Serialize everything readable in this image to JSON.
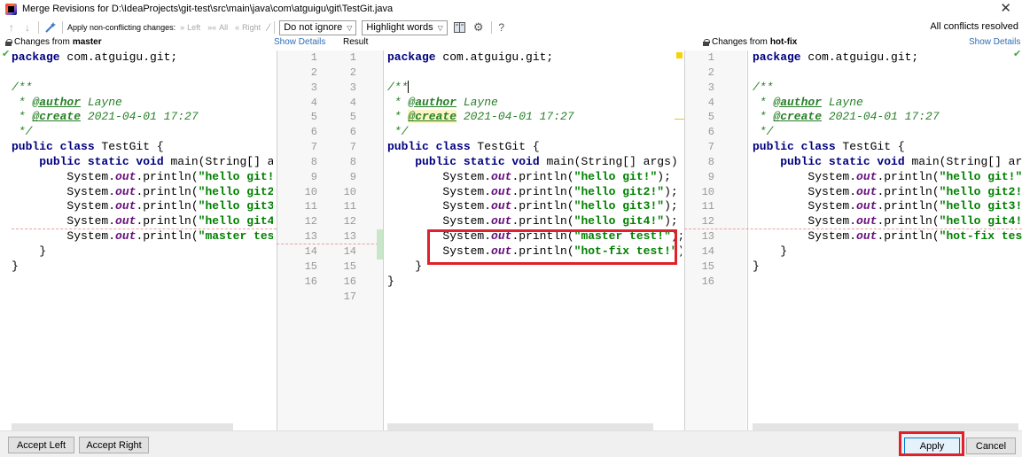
{
  "window": {
    "title": "Merge Revisions for D:\\IdeaProjects\\git-test\\src\\main\\java\\com\\atguigu\\git\\TestGit.java",
    "close_glyph": "✕"
  },
  "toolbar": {
    "up_glyph": "↑",
    "down_glyph": "↓",
    "apply_nonconflicting_label": "Apply non-conflicting changes:",
    "left_label": "Left",
    "all_label": "All",
    "right_label": "Right",
    "whitespace_option": "Do not ignore",
    "highlight_option": "Highlight words",
    "help_glyph": "?",
    "status": "All conflicts resolved"
  },
  "headers": {
    "left_prefix": "Changes from",
    "left_branch": "master",
    "left_link": "Show Details",
    "center": "Result",
    "right_prefix": "Changes from",
    "right_branch": "hot-fix",
    "right_link": "Show Details"
  },
  "gutter": {
    "left_numbers": [
      "1",
      "2",
      "3",
      "4",
      "5",
      "6",
      "7",
      "8",
      "9",
      "10",
      "11",
      "12",
      "13",
      "14",
      "15",
      "16"
    ],
    "result_numbers": [
      "1",
      "2",
      "3",
      "4",
      "5",
      "6",
      "7",
      "8",
      "9",
      "10",
      "11",
      "12",
      "13",
      "14",
      "15",
      "16",
      "17"
    ],
    "right_numbers": [
      "1",
      "2",
      "3",
      "4",
      "5",
      "6",
      "7",
      "8",
      "9",
      "10",
      "11",
      "12",
      "13",
      "14",
      "15",
      "16"
    ]
  },
  "code": {
    "package_kw": "package",
    "package_name": " com.atguigu.git;",
    "doc_open": "/**",
    "doc_star": " * ",
    "author_tag": "@author",
    "author_val": " Layne",
    "create_tag": "@create",
    "create_val": " 2021-04-01 17:27",
    "doc_close": " */",
    "class_kw": "public class",
    "class_name": " TestGit {",
    "method_kw": "public static void",
    "method_rest_full": " main(String[] args) {",
    "method_rest_left": " main(String[] arg",
    "method_rest_right": " main(String[] args",
    "sys": "System.",
    "out": "out",
    "println": ".println(",
    "close_brace": "}",
    "str_hello_git": "\"hello git!\"",
    "str_hello_git2": "\"hello git2!\"",
    "str_hello_git3": "\"hello git3!\"",
    "str_hello_git4": "\"hello git4!\"",
    "str_master_test": "\"master test!\"",
    "str_hotfix_test": "\"hot-fix test!\"",
    "paren_semi": ");",
    "paren": ")",
    "str_master_trunc": "\"master test!",
    "str_hotfix_trunc": "\"hot-fix test!"
  },
  "buttons": {
    "accept_left": "Accept Left",
    "accept_right": "Accept Right",
    "apply": "Apply",
    "cancel": "Cancel"
  }
}
